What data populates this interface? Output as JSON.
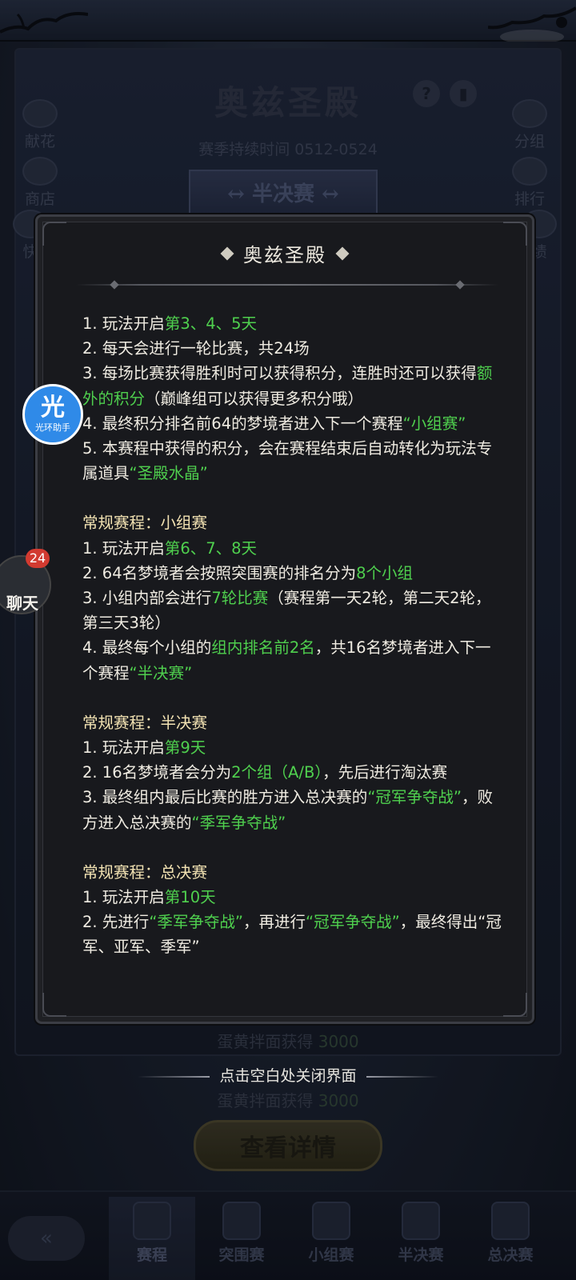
{
  "background": {
    "title": "奥兹圣殿",
    "help_glyph": "?",
    "season": "赛季持续时间 0512-0524",
    "stage": "↔ 半决赛 ↔",
    "left_buttons": [
      {
        "label": "献花",
        "icon": "flower-icon"
      },
      {
        "label": "商店",
        "icon": "shop-icon"
      },
      {
        "label": "快",
        "icon": "quick-icon"
      }
    ],
    "right_buttons": [
      {
        "label": "分组",
        "icon": "group-icon"
      },
      {
        "label": "排行",
        "icon": "rank-icon"
      },
      {
        "label": "绩",
        "icon": "record-icon"
      }
    ],
    "rewards": [
      {
        "label": "蛋黄拌面获得",
        "value": "3000"
      },
      {
        "label": "蛋黄拌面获得",
        "value": "3000"
      }
    ],
    "detail_button": "查看详情",
    "tabs": [
      {
        "label": "赛程",
        "icon": "schedule-icon",
        "active": true
      },
      {
        "label": "突围赛",
        "icon": "breakout-icon",
        "active": false
      },
      {
        "label": "小组赛",
        "icon": "group-stage-icon",
        "active": false
      },
      {
        "label": "半决赛",
        "icon": "semifinal-icon",
        "active": false
      },
      {
        "label": "总决赛",
        "icon": "final-icon",
        "active": false
      }
    ]
  },
  "modal": {
    "title": "奥兹圣殿",
    "rules_lines": [
      "1. 玩法开启第3、4、5天",
      "2. 每天会进行一轮比赛，共24场",
      "3. 每场比赛获得胜利时可以获得积分，连胜时还可以获得额外的积分（巅峰组可以获得更多积分哦）",
      "4. 最终积分排名前64的梦境者进入下一个赛程“小组赛”",
      "5. 本赛程中获得的积分，会在赛程结束后自动转化为玩法专属道具“圣殿水晶”",
      "常规赛程：小组赛",
      "1. 玩法开启第6、7、8天",
      "2. 64名梦境者会按照突围赛的排名分为8个小组",
      "3. 小组内部会进行7轮比赛（赛程第一天2轮，第二天2轮，第三天3轮）",
      "4. 最终每个小组的组内排名前2名，共16名梦境者进入下一个赛程“半决赛”",
      "常规赛程：半决赛",
      "1. 玩法开启第9天",
      "2. 16名梦境者会分为2个组（A/B），先后进行淘汰赛",
      "3. 最终组内最后比赛的胜方进入总决赛的“冠军争夺战”，败方进入总决赛的“季军争夺战”",
      "常规赛程：总决赛",
      "1. 玩法开启第10天",
      "2. 先进行“季军争夺战”，再进行“冠军争夺战”，最终得出“冠军、亚军、季军”"
    ],
    "highlights": [
      "第3、4、5天",
      "额外的积分",
      "“小组赛”",
      "“圣殿水晶”",
      "第6、7、8天",
      "8个小组",
      "7轮比赛",
      "组内排名前2名",
      "“半决赛”",
      "第9天",
      "2个组（A/B）",
      "“冠军争夺战”",
      "“季军争夺战”",
      "第10天"
    ],
    "highlight_color": "#4fd04e",
    "header_color": "#f3e3b3"
  },
  "close_hint": "点击空白处关闭界面",
  "assistant": {
    "big": "光",
    "small": "光环助手"
  },
  "chat": {
    "badge": "24",
    "label": "聊天"
  }
}
